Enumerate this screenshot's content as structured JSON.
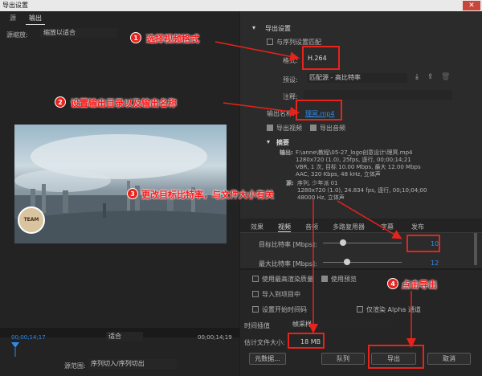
{
  "window": {
    "title": "导出设置",
    "close": "✕"
  },
  "left": {
    "tab_source": "源",
    "tab_output": "输出",
    "scale_label": "源缩放:",
    "scale_value": "缩放以适合",
    "time_start": "00;00;14;17",
    "time_end": "00;00;14;19",
    "fit_value": "适合",
    "range_label": "源范围:",
    "range_value": "序列切入/序列切出",
    "logo_text": "TEAM"
  },
  "export": {
    "section_title": "导出设置",
    "match_seq": "与序列设置匹配",
    "format_label": "格式:",
    "format_value": "H.264",
    "preset_label": "预设:",
    "preset_value": "匹配源 - 高比特率",
    "comment_label": "注释:",
    "output_label": "输出名称:",
    "output_value": "理冥.mp4",
    "export_video": "导出视频",
    "export_audio": "导出音频"
  },
  "summary": {
    "title": "摘要",
    "output_label": "输出:",
    "output_lines": [
      "F:\\anne\\教程\\05-27_logo创意设计\\理冥.mp4",
      "1280x720 (1.0), 25fps, 逐行, 00;00;14;21",
      "VBR, 1 次, 目标 10.00 Mbps, 最大 12.00 Mbps",
      "AAC, 320 Kbps, 48 kHz, 立体声"
    ],
    "source_label": "源:",
    "source_lines": [
      "序列, 少年派 01",
      "1280x720 (1.0), 24.834 fps, 逐行, 00;10;04;00",
      "48000 Hz, 立体声"
    ]
  },
  "tabs": [
    "效果",
    "视频",
    "音频",
    "多路复用器",
    "字幕",
    "发布"
  ],
  "bitrate": {
    "target_label": "目标比特率 [Mbps]:",
    "target_value": "10",
    "max_label": "最大比特率 [Mbps]:",
    "max_value": "12"
  },
  "bottom": {
    "max_render": "使用最高渲染质量",
    "use_preview": "使用预览",
    "import_project": "导入到项目中",
    "set_timecode": "设置开始时间码",
    "alpha_only": "仅渲染 Alpha 通道",
    "interp_label": "时间插值",
    "interp_value": "帧采样",
    "filesize_label": "估计文件大小:",
    "filesize_value": "18 MB",
    "metadata_btn": "元数据...",
    "queue_btn": "队列",
    "export_btn": "导出",
    "cancel_btn": "取消"
  },
  "callouts": [
    {
      "num": "1",
      "text": "选择视频格式"
    },
    {
      "num": "2",
      "text": "设置输出目录以及输出名称"
    },
    {
      "num": "3",
      "text": "更改目标比特率，与文件大小有关"
    },
    {
      "num": "4",
      "text": "点击导出"
    }
  ],
  "colors": {
    "accent": "#2d8ceb",
    "annotation": "#e8231b"
  }
}
